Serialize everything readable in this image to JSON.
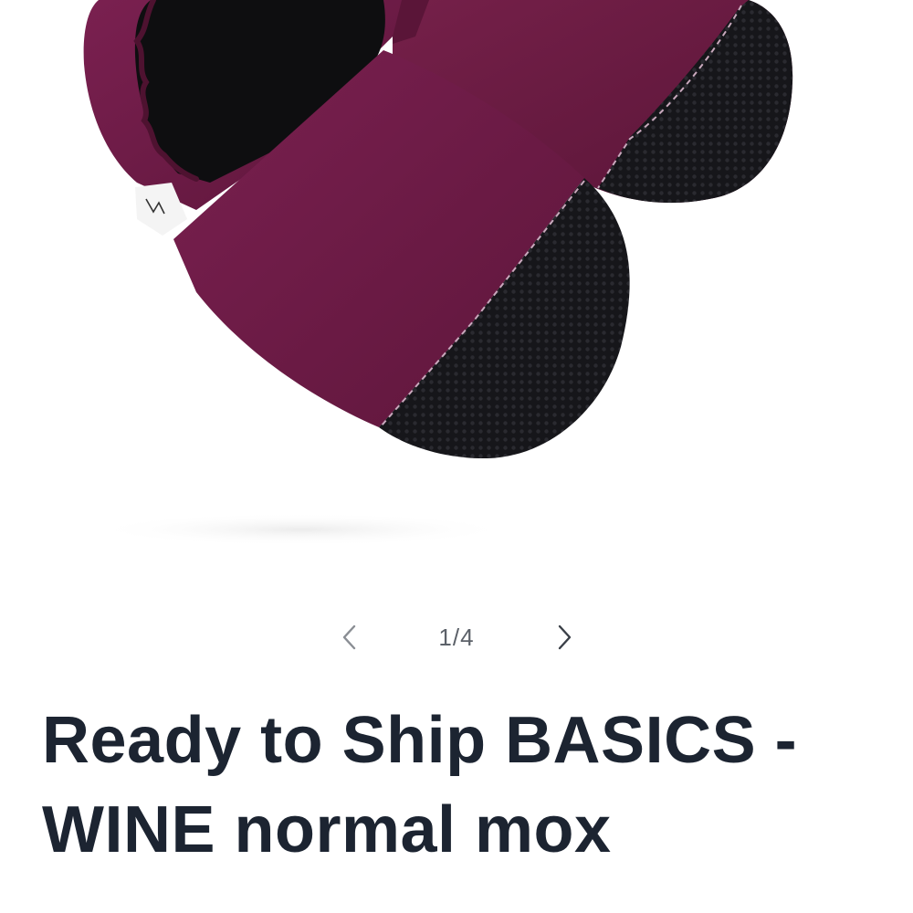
{
  "product": {
    "title": "Ready to Ship BASICS - WINE normal mox",
    "image_alt": "Wine colored soft sole baby shoes with black textured toe"
  },
  "slider": {
    "counter": "1/4",
    "prev_icon": "chevron-left-icon",
    "next_icon": "chevron-right-icon"
  },
  "colors": {
    "title_text": "#1c2431",
    "counter_text": "#5c6169",
    "chevron": "#7a7e85",
    "shoe_wine": "#6e1c45",
    "toe_black": "#141416",
    "background": "#ffffff"
  }
}
